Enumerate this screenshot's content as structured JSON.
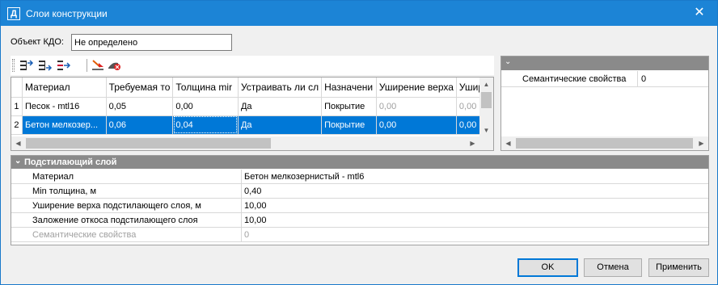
{
  "window": {
    "icon_letter": "Д",
    "title": "Слои конструкции",
    "close_glyph": "✕"
  },
  "object": {
    "label": "Объект КДО:",
    "value": "Не определено"
  },
  "layers_table": {
    "headers": [
      "",
      "Материал",
      "Требуемая то",
      "Толщина mir",
      "Устраивать ли сл",
      "Назначени",
      "Уширение верха",
      "Ушир"
    ],
    "rows": [
      [
        "1",
        "Песок - mtl16",
        "0,05",
        "0,00",
        "Да",
        "Покрытие",
        "0,00",
        "0,00"
      ],
      [
        "2",
        "Бетон мелкозер...",
        "0,06",
        "0,04",
        "Да",
        "Покрытие",
        "0,00",
        "0,00"
      ]
    ],
    "selected_row": 1
  },
  "scroll_glyphs": {
    "up": "▲",
    "down": "▼",
    "left": "◀",
    "right": "▶"
  },
  "properties_panel": {
    "chevron": "⌄",
    "rows": [
      {
        "key": "Семантические свойства",
        "value": "0"
      }
    ]
  },
  "underlying_layer": {
    "chevron": "⌄",
    "title": "Подстилающий слой",
    "rows": [
      {
        "key": "Материал",
        "value": "Бетон мелкозернистый - mtl6",
        "disabled": false
      },
      {
        "key": "Min толщина, м",
        "value": "0,40",
        "disabled": false
      },
      {
        "key": "Уширение верха подстилающего слоя, м",
        "value": "10,00",
        "disabled": false
      },
      {
        "key": "Заложение откоса подстилающего слоя",
        "value": "10,00",
        "disabled": false
      },
      {
        "key": "Семантические свойства",
        "value": "0",
        "disabled": true
      }
    ]
  },
  "buttons": {
    "ok": "OK",
    "cancel": "Отмена",
    "apply": "Применить"
  },
  "colors": {
    "titlebar": "#1c84d6",
    "selection": "#0078d7",
    "panel_header": "#8a8a8a"
  }
}
